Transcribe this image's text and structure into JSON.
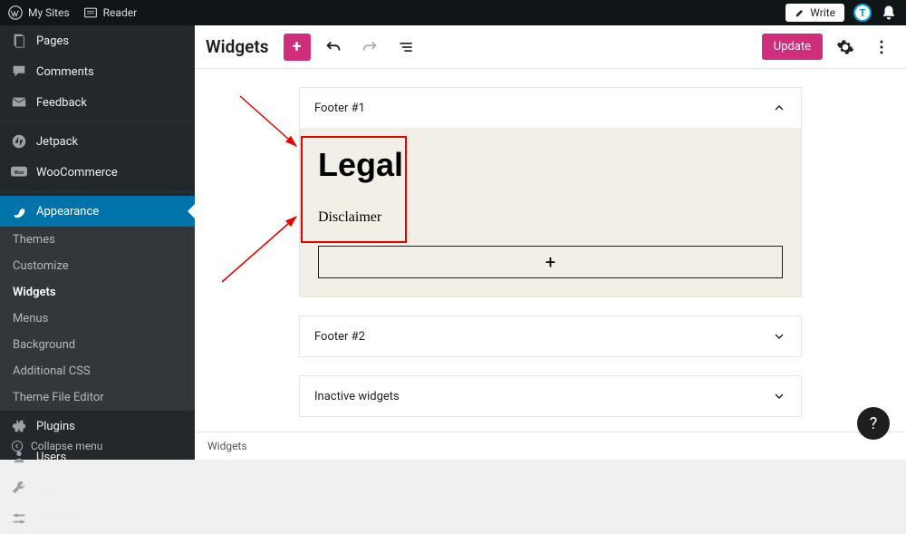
{
  "adminbar": {
    "my_sites": "My Sites",
    "reader": "Reader",
    "write": "Write",
    "user_initial": "T"
  },
  "sidebar": {
    "items": [
      {
        "label": "Pages"
      },
      {
        "label": "Comments"
      },
      {
        "label": "Feedback"
      },
      {
        "label": "Jetpack"
      },
      {
        "label": "WooCommerce"
      },
      {
        "label": "Appearance"
      },
      {
        "label": "Plugins"
      },
      {
        "label": "Users"
      },
      {
        "label": "Tools"
      },
      {
        "label": "Settings"
      }
    ],
    "appearance_submenu": [
      "Themes",
      "Customize",
      "Widgets",
      "Menus",
      "Background",
      "Additional CSS",
      "Theme File Editor"
    ],
    "collapse": "Collapse menu"
  },
  "editor": {
    "title": "Widgets",
    "update": "Update"
  },
  "areas": {
    "footer1": {
      "title": "Footer #1",
      "heading": "Legal",
      "paragraph": "Disclaimer"
    },
    "footer2": {
      "title": "Footer #2"
    },
    "inactive": {
      "title": "Inactive widgets"
    }
  },
  "footer_status": "Widgets",
  "help": "?"
}
